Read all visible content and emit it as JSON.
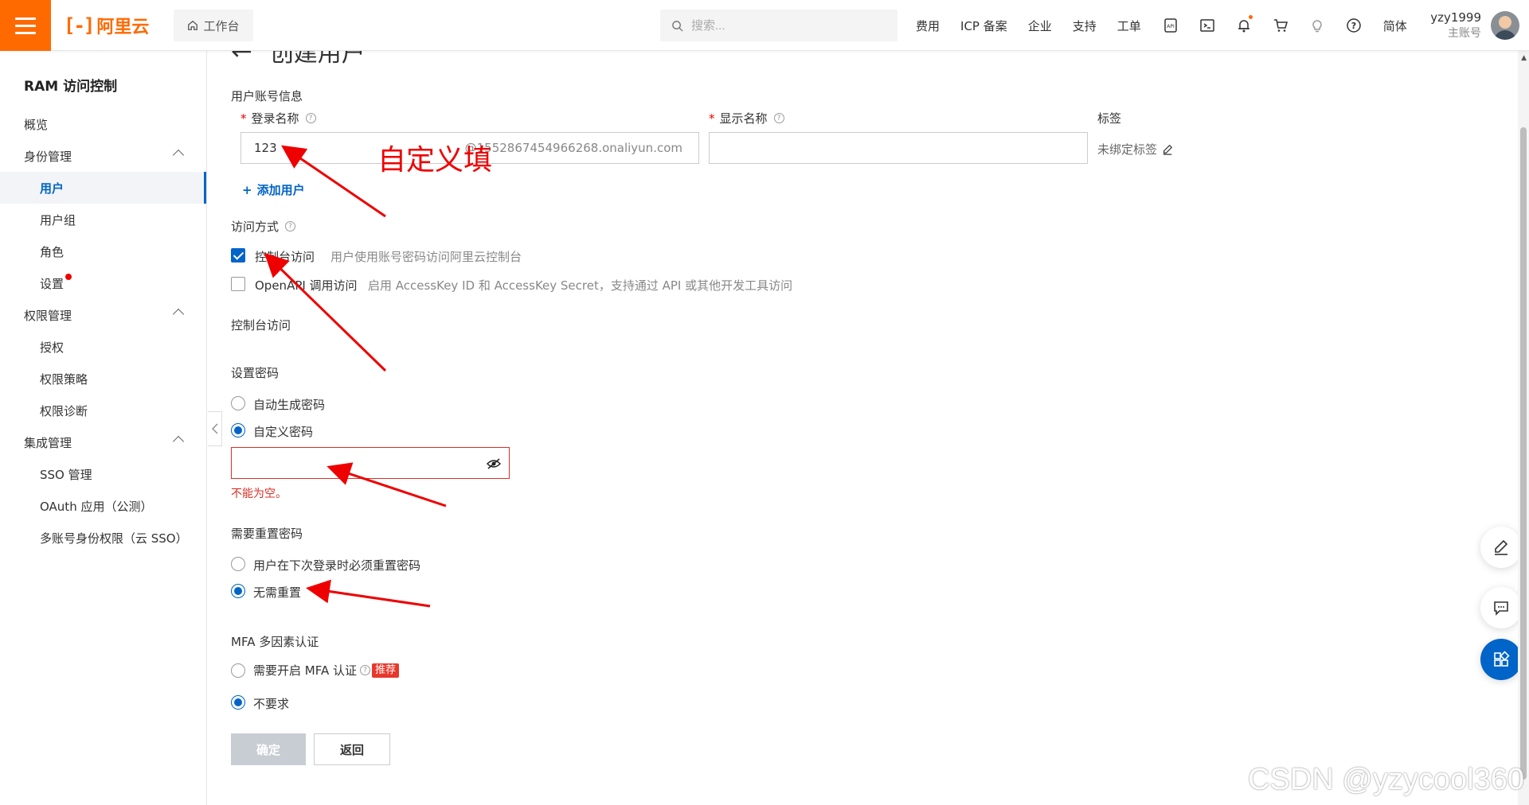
{
  "topbar": {
    "logo_text": "阿里云",
    "logo_mark": "[-]",
    "workbench": "工作台",
    "search_placeholder": "搜索...",
    "links": [
      "费用",
      "ICP 备案",
      "企业",
      "支持",
      "工单"
    ],
    "lang": "简体",
    "user_name": "yzy1999",
    "user_role": "主账号",
    "accent": "#ff6a00"
  },
  "sidebar": {
    "title": "RAM 访问控制",
    "items": [
      {
        "label": "概览",
        "level": 1
      },
      {
        "label": "身份管理",
        "level": 1,
        "expanded": true
      },
      {
        "label": "用户",
        "level": 2,
        "active": true
      },
      {
        "label": "用户组",
        "level": 2
      },
      {
        "label": "角色",
        "level": 2
      },
      {
        "label": "设置",
        "level": 2,
        "dot": true
      },
      {
        "label": "权限管理",
        "level": 1,
        "expanded": true
      },
      {
        "label": "授权",
        "level": 2
      },
      {
        "label": "权限策略",
        "level": 2
      },
      {
        "label": "权限诊断",
        "level": 2
      },
      {
        "label": "集成管理",
        "level": 1,
        "expanded": true
      },
      {
        "label": "SSO 管理",
        "level": 2
      },
      {
        "label": "OAuth 应用（公测）",
        "level": 2
      },
      {
        "label": "多账号身份权限（云 SSO）",
        "level": 2
      }
    ]
  },
  "form": {
    "title": "创建用户",
    "account_section": "用户账号信息",
    "login_name_label": "登录名称",
    "login_name_value": "123",
    "login_name_suffix": "@1552867454966268.onaliyun.com",
    "display_name_label": "显示名称",
    "display_name_value": "",
    "tags_label": "标签",
    "tags_value": "未绑定标签",
    "add_user": "添加用户",
    "access_section": "访问方式",
    "console_access_label": "控制台访问",
    "console_access_desc": "用户使用账号密码访问阿里云控制台",
    "console_access_checked": true,
    "api_access_label": "OpenAPI 调用访问",
    "api_access_desc": "启用 AccessKey ID 和 AccessKey Secret，支持通过 API 或其他开发工具访问",
    "api_access_checked": false,
    "console_section": "控制台访问",
    "password_section": "设置密码",
    "pw_auto": "自动生成密码",
    "pw_custom": "自定义密码",
    "pw_selected": "custom",
    "pw_value": "",
    "pw_error": "不能为空。",
    "reset_section": "需要重置密码",
    "reset_next": "用户在下次登录时必须重置密码",
    "reset_none": "无需重置",
    "reset_selected": "none",
    "mfa_section": "MFA 多因素认证",
    "mfa_required": "需要开启 MFA 认证",
    "mfa_badge": "推荐",
    "mfa_none": "不要求",
    "mfa_selected": "none",
    "confirm_btn": "确定",
    "back_btn": "返回"
  },
  "annotation": {
    "text": "自定义填",
    "color": "#ee0000"
  },
  "watermark": "CSDN @yzycool360"
}
